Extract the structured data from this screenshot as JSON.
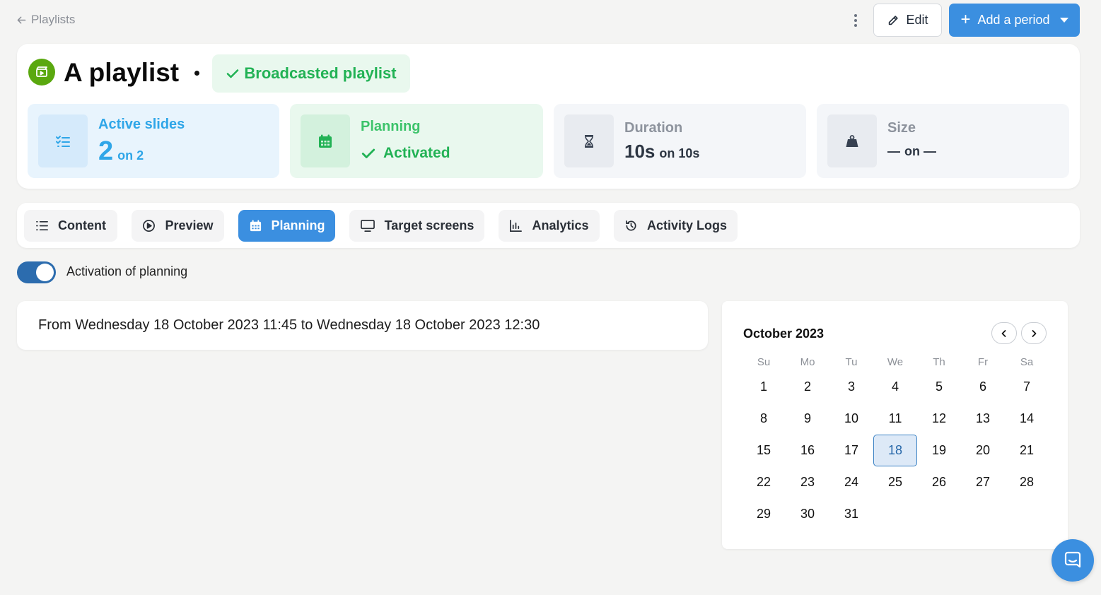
{
  "topbar": {
    "back_label": "Playlists",
    "edit_label": "Edit",
    "add_period_label": "Add a period"
  },
  "header": {
    "title": "A playlist",
    "badge": "Broadcasted playlist"
  },
  "stats": {
    "active_slides": {
      "label": "Active slides",
      "value": "2",
      "suffix": "on 2"
    },
    "planning": {
      "label": "Planning",
      "value": "Activated"
    },
    "duration": {
      "label": "Duration",
      "value": "10s",
      "suffix": "on 10s"
    },
    "size": {
      "label": "Size",
      "value": "—",
      "suffix": "on —"
    }
  },
  "tabs": [
    {
      "label": "Content",
      "icon": "list-icon"
    },
    {
      "label": "Preview",
      "icon": "play-circle-icon"
    },
    {
      "label": "Planning",
      "icon": "calendar-icon",
      "active": true
    },
    {
      "label": "Target screens",
      "icon": "monitor-icon"
    },
    {
      "label": "Analytics",
      "icon": "bar-chart-icon"
    },
    {
      "label": "Activity Logs",
      "icon": "history-icon"
    }
  ],
  "planning_toggle": {
    "label": "Activation of planning",
    "on": true
  },
  "period": {
    "text": "From Wednesday 18 October 2023 11:45 to Wednesday 18 October 2023 12:30"
  },
  "calendar": {
    "month_label": "October 2023",
    "weekdays": [
      "Su",
      "Mo",
      "Tu",
      "We",
      "Th",
      "Fr",
      "Sa"
    ],
    "weeks": [
      [
        "1",
        "2",
        "3",
        "4",
        "5",
        "6",
        "7"
      ],
      [
        "8",
        "9",
        "10",
        "11",
        "12",
        "13",
        "14"
      ],
      [
        "15",
        "16",
        "17",
        "18",
        "19",
        "20",
        "21"
      ],
      [
        "22",
        "23",
        "24",
        "25",
        "26",
        "27",
        "28"
      ],
      [
        "29",
        "30",
        "31"
      ]
    ],
    "selected_day": "18"
  },
  "colors": {
    "accent": "#3b8fe0",
    "success": "#22b255",
    "info": "#2fa6e8",
    "background": "#f4f4f3"
  }
}
